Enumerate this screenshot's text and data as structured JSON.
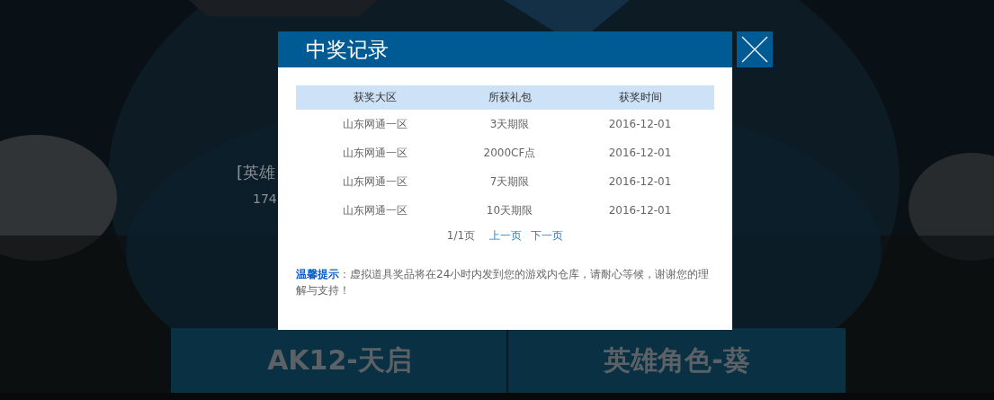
{
  "background": {
    "hero_title": "[英雄",
    "hero_subtitle": "174",
    "banners": [
      {
        "label": "AK12-天启"
      },
      {
        "label": "英雄角色-葵"
      }
    ]
  },
  "dialog": {
    "title": "中奖记录",
    "table": {
      "columns": [
        "获奖大区",
        "所获礼包",
        "获奖时间"
      ],
      "rows": [
        [
          "山东网通一区",
          "3天期限",
          "2016-12-01"
        ],
        [
          "山东网通一区",
          "2000CF点",
          "2016-12-01"
        ],
        [
          "山东网通一区",
          "7天期限",
          "2016-12-01"
        ],
        [
          "山东网通一区",
          "10天期限",
          "2016-12-01"
        ]
      ]
    },
    "pagination": {
      "page": "1/1页",
      "prev": "上一页",
      "next": "下一页"
    },
    "note": "**温馨提示**：虚拟道具奖品将在24小时内发到您的游戏内仓库，请耐心等候，谢谢您的理解与支持！"
  }
}
